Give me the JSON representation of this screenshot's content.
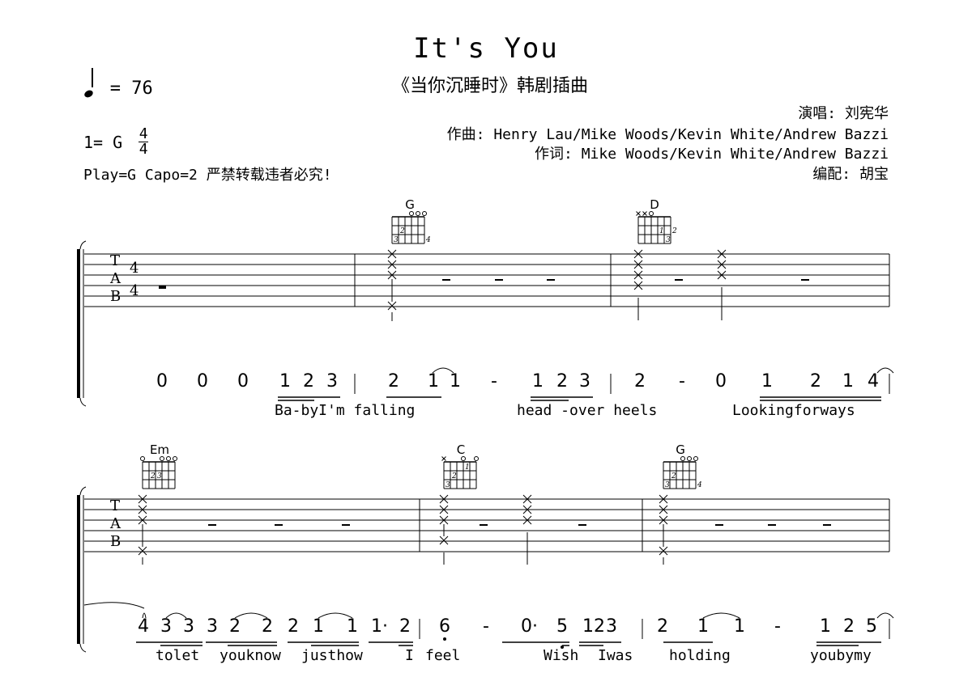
{
  "header": {
    "title": "It's You",
    "subtitle": "《当你沉睡时》韩剧插曲",
    "tempo_symbol": "quarter-note",
    "tempo_text": "= 76",
    "key_label": "1= G",
    "time_signature": {
      "top": "4",
      "bottom": "4"
    },
    "play_info": "Play=G Capo=2 严禁转载违者必究!",
    "credits": {
      "singer": "演唱: 刘宪华",
      "composer": "作曲: Henry Lau/Mike Woods/Kevin White/Andrew Bazzi",
      "lyricist": "作词: Mike Woods/Kevin White/Andrew Bazzi",
      "arranger": "编配: 胡宝"
    }
  },
  "tab_clef": {
    "letters": [
      "T",
      "A",
      "B"
    ],
    "time_top": "4",
    "time_bottom": "4"
  },
  "systems": [
    {
      "chords": [
        {
          "name": "G",
          "open_strings": "ooo",
          "fingers": [
            "2",
            "3",
            "4"
          ]
        },
        {
          "name": "D",
          "open_strings": "xxo",
          "fingers": [
            "1",
            "2",
            "3"
          ]
        }
      ],
      "jianpu": [
        "0",
        "0",
        "0",
        "1",
        "2",
        "3",
        "2",
        "1",
        "1",
        "-",
        "1",
        "2",
        "3",
        "2",
        "-",
        "0",
        "1",
        "2",
        "1",
        "4"
      ],
      "lyrics": [
        "Ba-byI'm falling",
        "head -over heels",
        "Lookingforways"
      ]
    },
    {
      "chords": [
        {
          "name": "Em",
          "open_strings": "o ooo",
          "fingers": [
            "2",
            "3"
          ]
        },
        {
          "name": "C",
          "open_strings": "x o o",
          "fingers": [
            "1",
            "2",
            "3"
          ]
        },
        {
          "name": "G",
          "open_strings": "ooo",
          "fingers": [
            "2",
            "3",
            "4"
          ]
        }
      ],
      "jianpu": [
        "4",
        "3",
        "3",
        "3",
        "2",
        "2",
        "2",
        "1",
        "1",
        "1·",
        "2",
        "6",
        "-",
        "0·",
        "5",
        "12",
        "3",
        "2",
        "1",
        "1",
        "-",
        "1",
        "2",
        "5"
      ],
      "lyrics": [
        "tolet",
        "youknow",
        "justhow",
        "I",
        "feel",
        "Wish",
        "Iwas",
        "holding",
        "youbymy"
      ]
    }
  ]
}
